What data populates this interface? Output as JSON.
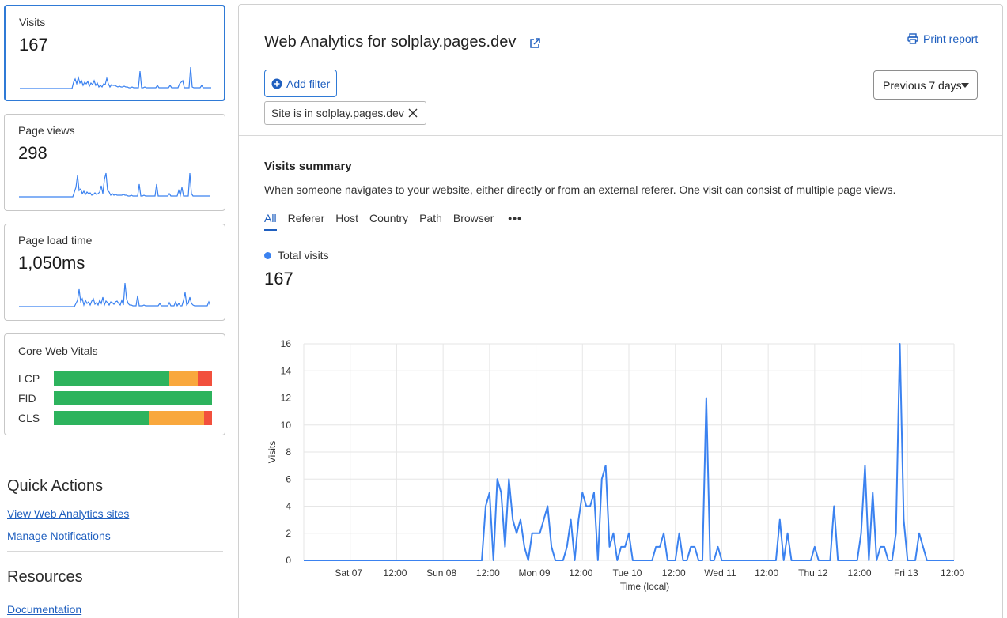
{
  "cards": {
    "visits": {
      "label": "Visits",
      "value": "167"
    },
    "page_views": {
      "label": "Page views",
      "value": "298"
    },
    "page_load_time": {
      "label": "Page load time",
      "value": "1,050ms"
    }
  },
  "core_web_vitals": {
    "title": "Core Web Vitals",
    "metrics": [
      {
        "name": "LCP",
        "good": 0.73,
        "needs_improvement": 0.18,
        "poor": 0.09
      },
      {
        "name": "FID",
        "good": 1.0,
        "needs_improvement": 0.0,
        "poor": 0.0
      },
      {
        "name": "CLS",
        "good": 0.6,
        "needs_improvement": 0.35,
        "poor": 0.05
      }
    ]
  },
  "quick_actions": {
    "title": "Quick Actions",
    "links": [
      "View Web Analytics sites",
      "Manage Notifications"
    ]
  },
  "resources": {
    "title": "Resources",
    "links": [
      "Documentation"
    ]
  },
  "header": {
    "title": "Web Analytics for solplay.pages.dev",
    "print_label": "Print report",
    "add_filter_label": "Add filter",
    "filter_chip": "Site is in solplay.pages.dev",
    "period_label": "Previous 7 days"
  },
  "summary": {
    "title": "Visits summary",
    "description": "When someone navigates to your website, either directly or from an external referer. One visit can consist of multiple page views.",
    "tabs": [
      "All",
      "Referer",
      "Host",
      "Country",
      "Path",
      "Browser"
    ],
    "active_tab": "All",
    "legend": "Total visits",
    "total": "167"
  },
  "colors": {
    "accent": "#1f5fbf",
    "series": "#3b82f0",
    "good": "#2db35d",
    "needs_improvement": "#f9a83d",
    "poor": "#f2503d"
  },
  "chart_data": {
    "type": "line",
    "xlabel": "Time (local)",
    "ylabel": "Visits",
    "ylim": [
      0,
      16
    ],
    "yticks": [
      0,
      2,
      4,
      6,
      8,
      10,
      12,
      14,
      16
    ],
    "xticks": [
      "Sat 07",
      "12:00",
      "Sun 08",
      "12:00",
      "Mon 09",
      "12:00",
      "Tue 10",
      "12:00",
      "Wed 11",
      "12:00",
      "Thu 12",
      "12:00",
      "Fri 13",
      "12:00"
    ],
    "grid": true,
    "series": [
      {
        "name": "Total visits",
        "x_hours": [
          0,
          1,
          2,
          3,
          4,
          5,
          6,
          7,
          8,
          9,
          10,
          11,
          12,
          13,
          14,
          15,
          16,
          17,
          18,
          19,
          20,
          21,
          22,
          23,
          24,
          25,
          26,
          27,
          28,
          29,
          30,
          31,
          32,
          33,
          34,
          35,
          36,
          37,
          38,
          39,
          40,
          41,
          42,
          43,
          44,
          45,
          46,
          47,
          48,
          49,
          50,
          51,
          52,
          53,
          54,
          55,
          56,
          57,
          58,
          59,
          60,
          61,
          62,
          63,
          64,
          65,
          66,
          67,
          68,
          69,
          70,
          71,
          72,
          73,
          74,
          75,
          76,
          77,
          78,
          79,
          80,
          81,
          82,
          83,
          84,
          85,
          86,
          87,
          88,
          89,
          90,
          91,
          92,
          93,
          94,
          95,
          96,
          97,
          98,
          99,
          100,
          101,
          102,
          103,
          104,
          105,
          106,
          107,
          108,
          109,
          110,
          111,
          112,
          113,
          114,
          115,
          116,
          117,
          118,
          119,
          120,
          121,
          122,
          123,
          124,
          125,
          126,
          127,
          128,
          129,
          130,
          131,
          132,
          133,
          134,
          135,
          136,
          137,
          138,
          139,
          140,
          141,
          142,
          143,
          144,
          145,
          146,
          147,
          148,
          149,
          150,
          151,
          152,
          153,
          154,
          155,
          156,
          157,
          158,
          159,
          160,
          161,
          162,
          163,
          164,
          165,
          166,
          167,
          168
        ],
        "values": [
          0,
          0,
          0,
          0,
          0,
          0,
          0,
          0,
          0,
          0,
          0,
          0,
          0,
          0,
          0,
          0,
          0,
          0,
          0,
          0,
          0,
          0,
          0,
          0,
          0,
          0,
          0,
          0,
          0,
          0,
          0,
          0,
          0,
          0,
          0,
          0,
          0,
          0,
          0,
          0,
          0,
          0,
          0,
          0,
          0,
          0,
          0,
          4,
          5,
          0,
          6,
          5,
          1,
          6,
          3,
          2,
          3,
          1,
          0,
          2,
          2,
          2,
          3,
          4,
          1,
          0,
          0,
          0,
          1,
          3,
          0,
          3,
          5,
          4,
          4,
          5,
          0,
          6,
          7,
          1,
          2,
          0,
          1,
          1,
          2,
          0,
          0,
          0,
          0,
          0,
          0,
          1,
          1,
          2,
          0,
          0,
          0,
          2,
          0,
          0,
          1,
          1,
          0,
          0,
          12,
          0,
          0,
          1,
          0,
          0,
          0,
          0,
          0,
          0,
          0,
          0,
          0,
          0,
          0,
          0,
          0,
          0,
          0,
          3,
          0,
          2,
          0,
          0,
          0,
          0,
          0,
          0,
          1,
          0,
          0,
          0,
          0,
          4,
          0,
          0,
          0,
          0,
          0,
          0,
          2,
          7,
          0,
          5,
          0,
          1,
          1,
          0,
          0,
          2,
          16,
          3,
          0,
          0,
          0,
          2,
          1,
          0,
          0,
          0,
          0,
          0,
          0,
          0,
          0,
          1
        ]
      }
    ]
  }
}
